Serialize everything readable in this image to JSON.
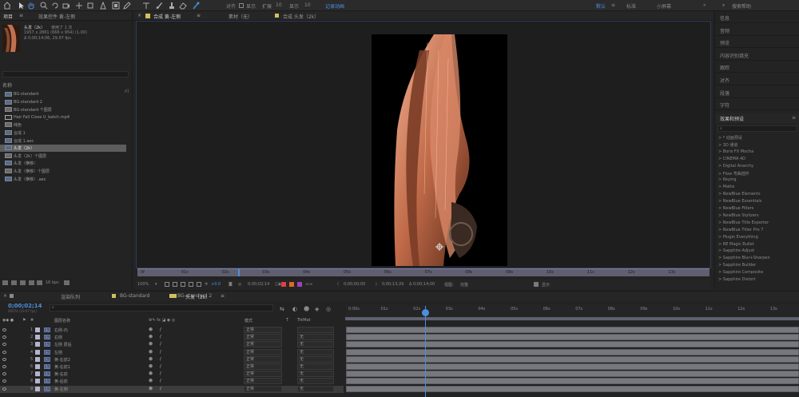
{
  "toolbar": {
    "align": "对齐",
    "snap": "显示",
    "expand": "扩展",
    "display": "显示",
    "sz": "10",
    "extend": "记录动画",
    "workspace_default": "默认",
    "workspace_learn": "标准",
    "workspace_small": "小屏幕",
    "search_placeholder": "搜索帮助"
  },
  "project": {
    "tab_project": "项目",
    "tab_effects": "效果控件 黄-左侧",
    "item_name": "头发（2k）",
    "item_used": "使用了 1 次",
    "info_line1": "1957 x 2861 (666 x 954) (1.00)",
    "info_line2": "Δ 0;00;14;06, 29.97 fps",
    "name_header": "名称",
    "items": [
      "BG-standard",
      "BG-standard 2",
      "BG-standard 个图层",
      "Hair Fall Close U_batch.mp4",
      "纯色",
      "合成 1",
      "合成 1.aec",
      "头发（2k）",
      "头发（2k）个图层",
      "头发（横移）",
      "头发（横移）个图层",
      "头发（横移）.aec"
    ],
    "footer_bpc": "16 bpc"
  },
  "viewer": {
    "tab_comp": "合成 黄-左侧",
    "tab_layer": "素材（无）",
    "tab_flow": "合成 头发（2k）",
    "ruler_labels": [
      "0f",
      "01s",
      "02s",
      "03s",
      "04s",
      "05s",
      "06s",
      "07s",
      "08s",
      "09s",
      "10s",
      "11s",
      "12s",
      "13s"
    ],
    "zoom": "100%",
    "timecode": "0;00;02;14",
    "res": "完整",
    "start": "0;00;00;00",
    "end": "0;00;13;29",
    "dur": "Δ 0;00;14;00",
    "view": "视图：",
    "view_val": "完整",
    "show": "显示",
    "plus": "+0.0"
  },
  "right_panel": {
    "items": [
      "信息",
      "音频",
      "预览",
      "内容识别填充",
      "跟踪",
      "对齐",
      "段落",
      "字符"
    ],
    "fx_header": "效果和预设",
    "fx_items": [
      "> * 动画预设",
      "> 3D 通道",
      "> Boris FX Mocha",
      "> CINEMA 4D",
      "> Digital Anarchy",
      "> Flow 弯曲插件",
      "> Keying",
      "> Matte",
      "> NewBlue Elements",
      "> NewBlue Essentials",
      "> NewBlue Filters",
      "> NewBlue Stylizers",
      "> NewBlue Title Exporter",
      "> NewBlue Titler Pro 7",
      "> Plugin Everything",
      "> RE Magic Bullet",
      "> Sapphire Adjust",
      "> Sapphire Blur+Sharpen",
      "> Sapphire Builder",
      "> Sapphire Composite",
      "> Sapphire Distort"
    ]
  },
  "timeline": {
    "tab_render": "渲染队列",
    "tab_bg": "BG-standard",
    "tab_bg2": "BG-standard 2",
    "tab_hair": "头发（2k）",
    "timecode": "0;00;02;14",
    "timecode_sub": "00074 (29.97 fps)",
    "col_layer_name": "图层名称",
    "col_mode": "模式",
    "col_trkmat": "TrkMat",
    "ruler_labels": [
      "0:00s",
      "01s",
      "02s",
      "03s",
      "04s",
      "05s",
      "06s",
      "07s",
      "08s",
      "09s",
      "10s",
      "11s",
      "12s",
      "13s",
      "14"
    ],
    "layers": [
      {
        "num": "1",
        "name": "右侧-内",
        "mode": "正常",
        "trk": ""
      },
      {
        "num": "2",
        "name": "右侧",
        "mode": "正常",
        "trk": "无"
      },
      {
        "num": "3",
        "name": "左侧 层后",
        "mode": "正常",
        "trk": "无"
      },
      {
        "num": "4",
        "name": "左侧",
        "mode": "正常",
        "trk": "无"
      },
      {
        "num": "5",
        "name": "黄-右前2",
        "mode": "正常",
        "trk": "无"
      },
      {
        "num": "6",
        "name": "黄-右前1",
        "mode": "正常",
        "trk": "无"
      },
      {
        "num": "7",
        "name": "黄-右前",
        "mode": "正常",
        "trk": "无"
      },
      {
        "num": "8",
        "name": "黄-后前",
        "mode": "正常",
        "trk": "无"
      },
      {
        "num": "9",
        "name": "黄-左侧",
        "mode": "正常",
        "trk": "无"
      }
    ]
  },
  "colors": {
    "accent_blue": "#4b8fe0",
    "panel_bg": "#232323",
    "workspace_active": "#4b8fe0",
    "highlight_yellow": "#d0c060"
  },
  "icons": [
    "selection-tool-icon",
    "hand-tool-icon",
    "zoom-tool-icon",
    "pen-tool-icon",
    "text-tool-icon",
    "brush-tool-icon",
    "puppet-tool-icon",
    "search-icon",
    "eye-icon",
    "folder-icon"
  ]
}
